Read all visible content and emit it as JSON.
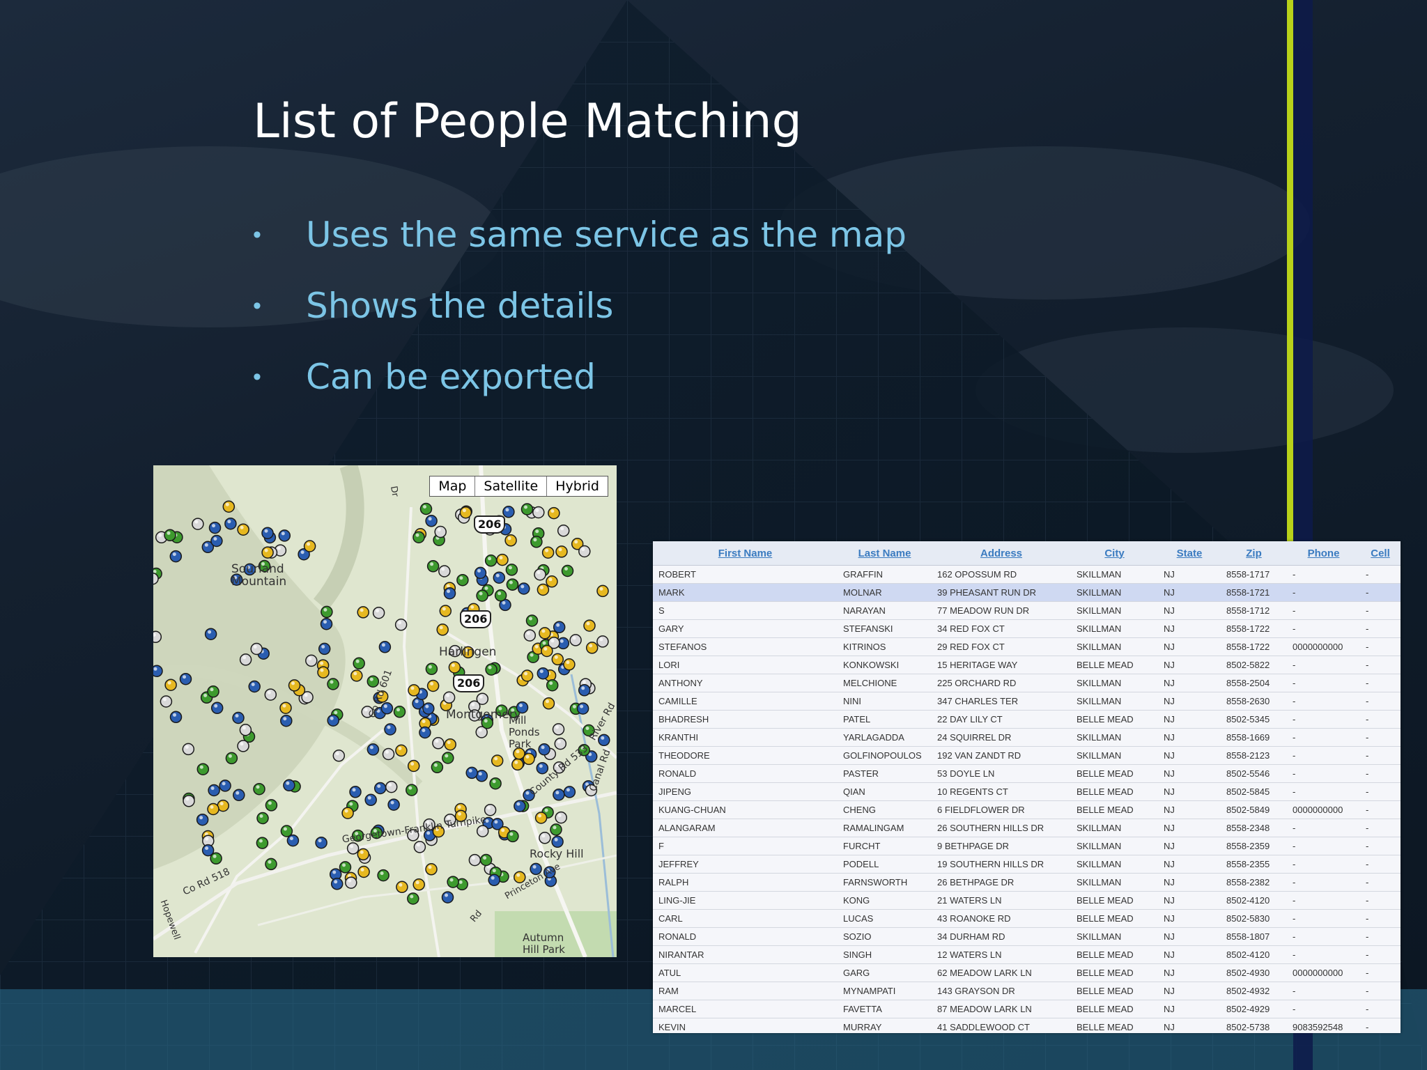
{
  "slide": {
    "title": "List of People Matching",
    "bullets": [
      "Uses the same service as the map",
      "Shows the details",
      "Can be exported"
    ],
    "bullet_glyph": "•"
  },
  "colors": {
    "title": "#ffffff",
    "bullet_text": "#7cc5e6",
    "accent_stripe": "#b8d11a",
    "table_header": "#3a7bc0",
    "row_highlight": "#cfd9f2"
  },
  "map": {
    "buttons": [
      "Map",
      "Satellite",
      "Hybrid"
    ],
    "route_shields": [
      "206",
      "206",
      "206"
    ],
    "labels": [
      "Sourland Mountain",
      "Harlingen",
      "Co Rd 601",
      "Montgomery",
      "Mill Ponds Park",
      "County Rd 533",
      "River Rd",
      "Canal Rd",
      "Georgetown-Franklin Turnpike",
      "Co Rd 518",
      "Rocky Hill",
      "Autumn Hill Park",
      "Hopewell",
      "Princeton Ave",
      "Dr",
      "Rd"
    ],
    "marker_icon": "map-pin-icon"
  },
  "table": {
    "columns": [
      "First Name",
      "Last Name",
      "Address",
      "City",
      "State",
      "Zip",
      "Phone",
      "Cell"
    ],
    "highlighted_row": 1,
    "rows": [
      [
        "ROBERT",
        "GRAFFIN",
        "162 OPOSSUM RD",
        "SKILLMAN",
        "NJ",
        "8558-1717",
        "-",
        "-"
      ],
      [
        "MARK",
        "MOLNAR",
        "39 PHEASANT RUN DR",
        "SKILLMAN",
        "NJ",
        "8558-1721",
        "-",
        "-"
      ],
      [
        "S",
        "NARAYAN",
        "77 MEADOW RUN DR",
        "SKILLMAN",
        "NJ",
        "8558-1712",
        "-",
        "-"
      ],
      [
        "GARY",
        "STEFANSKI",
        "34 RED FOX CT",
        "SKILLMAN",
        "NJ",
        "8558-1722",
        "-",
        "-"
      ],
      [
        "STEFANOS",
        "KITRINOS",
        "29 RED FOX CT",
        "SKILLMAN",
        "NJ",
        "8558-1722",
        "0000000000",
        "-"
      ],
      [
        "LORI",
        "KONKOWSKI",
        "15 HERITAGE WAY",
        "BELLE MEAD",
        "NJ",
        "8502-5822",
        "-",
        "-"
      ],
      [
        "ANTHONY",
        "MELCHIONE",
        "225 ORCHARD RD",
        "SKILLMAN",
        "NJ",
        "8558-2504",
        "-",
        "-"
      ],
      [
        "CAMILLE",
        "NINI",
        "347 CHARLES TER",
        "SKILLMAN",
        "NJ",
        "8558-2630",
        "-",
        "-"
      ],
      [
        "BHADRESH",
        "PATEL",
        "22 DAY LILY CT",
        "BELLE MEAD",
        "NJ",
        "8502-5345",
        "-",
        "-"
      ],
      [
        "KRANTHI",
        "YARLAGADDA",
        "24 SQUIRREL DR",
        "SKILLMAN",
        "NJ",
        "8558-1669",
        "-",
        "-"
      ],
      [
        "THEODORE",
        "GOLFINOPOULOS",
        "192 VAN ZANDT RD",
        "SKILLMAN",
        "NJ",
        "8558-2123",
        "-",
        "-"
      ],
      [
        "RONALD",
        "PASTER",
        "53 DOYLE LN",
        "BELLE MEAD",
        "NJ",
        "8502-5546",
        "-",
        "-"
      ],
      [
        "JIPENG",
        "QIAN",
        "10 REGENTS CT",
        "BELLE MEAD",
        "NJ",
        "8502-5845",
        "-",
        "-"
      ],
      [
        "KUANG-CHUAN",
        "CHENG",
        "6 FIELDFLOWER DR",
        "BELLE MEAD",
        "NJ",
        "8502-5849",
        "0000000000",
        "-"
      ],
      [
        "ALANGARAM",
        "RAMALINGAM",
        "26 SOUTHERN HILLS DR",
        "SKILLMAN",
        "NJ",
        "8558-2348",
        "-",
        "-"
      ],
      [
        "F",
        "FURCHT",
        "9 BETHPAGE DR",
        "SKILLMAN",
        "NJ",
        "8558-2359",
        "-",
        "-"
      ],
      [
        "JEFFREY",
        "PODELL",
        "19 SOUTHERN HILLS DR",
        "SKILLMAN",
        "NJ",
        "8558-2355",
        "-",
        "-"
      ],
      [
        "RALPH",
        "FARNSWORTH",
        "26 BETHPAGE DR",
        "SKILLMAN",
        "NJ",
        "8558-2382",
        "-",
        "-"
      ],
      [
        "LING-JIE",
        "KONG",
        "21 WATERS LN",
        "BELLE MEAD",
        "NJ",
        "8502-4120",
        "-",
        "-"
      ],
      [
        "CARL",
        "LUCAS",
        "43 ROANOKE RD",
        "BELLE MEAD",
        "NJ",
        "8502-5830",
        "-",
        "-"
      ],
      [
        "RONALD",
        "SOZIO",
        "34 DURHAM RD",
        "SKILLMAN",
        "NJ",
        "8558-1807",
        "-",
        "-"
      ],
      [
        "NIRANTAR",
        "SINGH",
        "12 WATERS LN",
        "BELLE MEAD",
        "NJ",
        "8502-4120",
        "-",
        "-"
      ],
      [
        "ATUL",
        "GARG",
        "62 MEADOW LARK LN",
        "BELLE MEAD",
        "NJ",
        "8502-4930",
        "0000000000",
        "-"
      ],
      [
        "RAM",
        "MYNAMPATI",
        "143 GRAYSON DR",
        "BELLE MEAD",
        "NJ",
        "8502-4932",
        "-",
        "-"
      ],
      [
        "MARCEL",
        "FAVETTA",
        "87 MEADOW LARK LN",
        "BELLE MEAD",
        "NJ",
        "8502-4929",
        "-",
        "-"
      ],
      [
        "KEVIN",
        "MURRAY",
        "41 SADDLEWOOD CT",
        "BELLE MEAD",
        "NJ",
        "8502-5738",
        "9083592548",
        "-"
      ]
    ]
  }
}
